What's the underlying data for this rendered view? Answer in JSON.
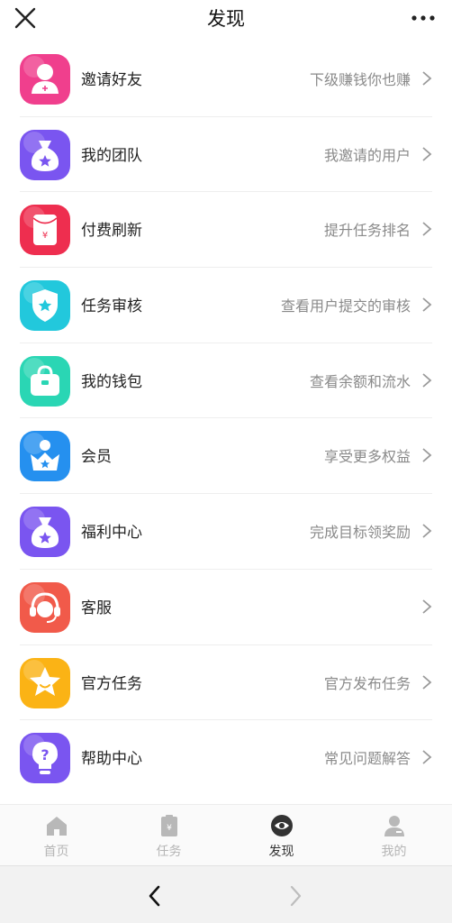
{
  "header": {
    "title": "发现",
    "close_icon": "close-icon",
    "more_icon": "more-icon"
  },
  "menu": [
    {
      "key": "invite",
      "label": "邀请好友",
      "sub": "下级赚钱你也赚",
      "icon": "invite-user-icon",
      "color": "#f03f8d"
    },
    {
      "key": "team",
      "label": "我的团队",
      "sub": "我邀请的用户",
      "icon": "team-bag-icon",
      "color": "#7a55f0"
    },
    {
      "key": "refresh",
      "label": "付费刷新",
      "sub": "提升任务排名",
      "icon": "red-envelope-icon",
      "color": "#ee2e4f"
    },
    {
      "key": "review",
      "label": "任务审核",
      "sub": "查看用户提交的审核",
      "icon": "shield-star-icon",
      "color": "#22c8dc"
    },
    {
      "key": "wallet",
      "label": "我的钱包",
      "sub": "查看余额和流水",
      "icon": "wallet-icon",
      "color": "#2ad6b4"
    },
    {
      "key": "vip",
      "label": "会员",
      "sub": "享受更多权益",
      "icon": "crown-user-icon",
      "color": "#2590ef"
    },
    {
      "key": "welfare",
      "label": "福利中心",
      "sub": "完成目标领奖励",
      "icon": "gift-bag-icon",
      "color": "#7a55f0"
    },
    {
      "key": "service",
      "label": "客服",
      "sub": "",
      "icon": "headset-icon",
      "color": "#f15a4a"
    },
    {
      "key": "official",
      "label": "官方任务",
      "sub": "官方发布任务",
      "icon": "star-icon",
      "color": "#fbb315"
    },
    {
      "key": "help",
      "label": "帮助中心",
      "sub": "常见问题解答",
      "icon": "help-bulb-icon",
      "color": "#7a55f0"
    }
  ],
  "tabs": [
    {
      "label": "首页",
      "icon": "home-icon"
    },
    {
      "label": "任务",
      "icon": "task-icon"
    },
    {
      "label": "发现",
      "icon": "eye-icon",
      "active": true
    },
    {
      "label": "我的",
      "icon": "profile-icon"
    }
  ],
  "nav": {
    "back_icon": "back-arrow-icon",
    "forward_icon": "forward-arrow-icon"
  }
}
